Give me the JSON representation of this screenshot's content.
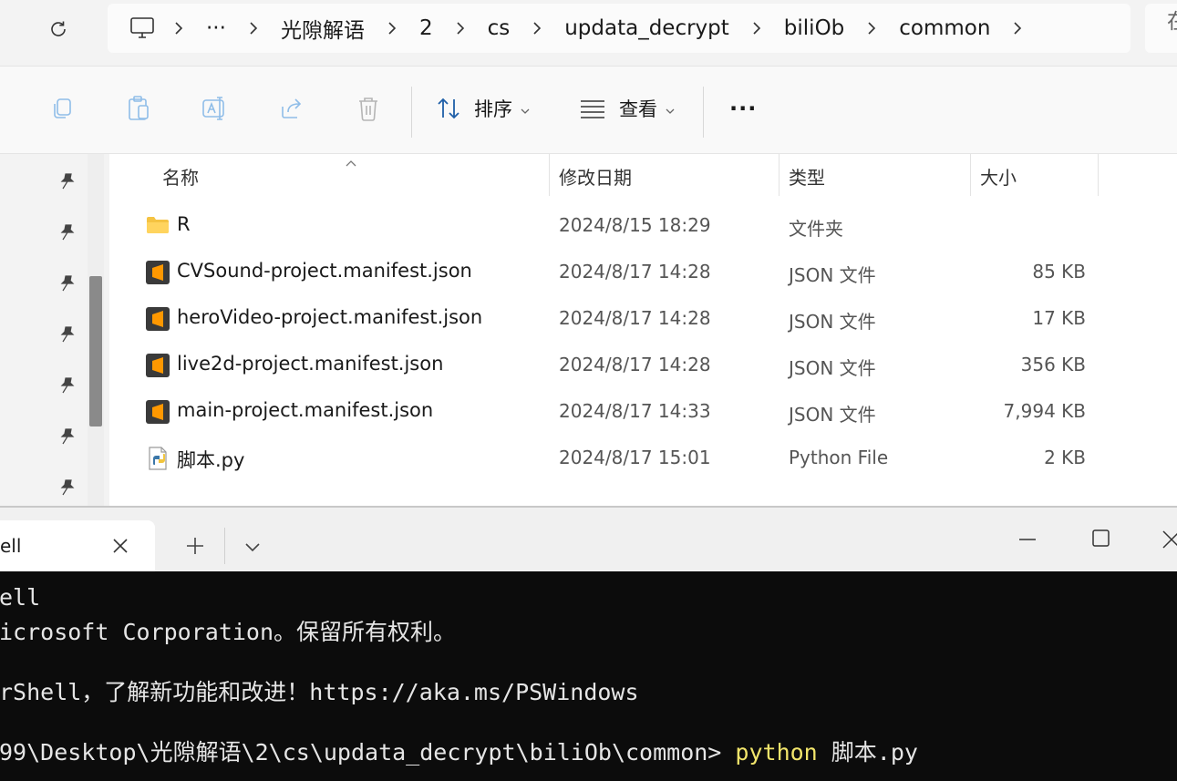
{
  "explorer": {
    "breadcrumb": {
      "more": "···",
      "items": [
        "光隙解语",
        "2",
        "cs",
        "updata_decrypt",
        "biliOb",
        "common"
      ]
    },
    "search_edge_text": "在",
    "toolbar": {
      "sort_label": "排序",
      "view_label": "查看",
      "more_label": "···"
    },
    "columns": {
      "name": "名称",
      "date": "修改日期",
      "type": "类型",
      "size": "大小"
    },
    "files": [
      {
        "name": "R",
        "date": "2024/8/15 18:29",
        "type": "文件夹",
        "size": "",
        "icon": "folder-icon"
      },
      {
        "name": "CVSound-project.manifest.json",
        "date": "2024/8/17 14:28",
        "type": "JSON 文件",
        "size": "85 KB",
        "icon": "sublime-json-icon"
      },
      {
        "name": "heroVideo-project.manifest.json",
        "date": "2024/8/17 14:28",
        "type": "JSON 文件",
        "size": "17 KB",
        "icon": "sublime-json-icon"
      },
      {
        "name": "live2d-project.manifest.json",
        "date": "2024/8/17 14:28",
        "type": "JSON 文件",
        "size": "356 KB",
        "icon": "sublime-json-icon"
      },
      {
        "name": "main-project.manifest.json",
        "date": "2024/8/17 14:33",
        "type": "JSON 文件",
        "size": "7,994 KB",
        "icon": "sublime-json-icon"
      },
      {
        "name": "脚本.py",
        "date": "2024/8/17 15:01",
        "type": "Python File",
        "size": "2 KB",
        "icon": "python-file-icon"
      }
    ]
  },
  "terminal": {
    "tab_title": "ell",
    "lines": [
      "ell",
      "icrosoft Corporation。保留所有权利。",
      "",
      "rShell，了解新功能和改进！https://aka.ms/PSWindows",
      ""
    ],
    "prompt": "99\\Desktop\\光隙解语\\2\\cs\\updata_decrypt\\biliOb\\common> ",
    "command": "python",
    "argument": " 脚本.py"
  },
  "colors": {
    "accent": "#0067c0",
    "folder": "#f5c342",
    "sublime": "#ff9800",
    "terminal_bg": "#0c0c0c",
    "terminal_cmd": "#f2e56b"
  }
}
